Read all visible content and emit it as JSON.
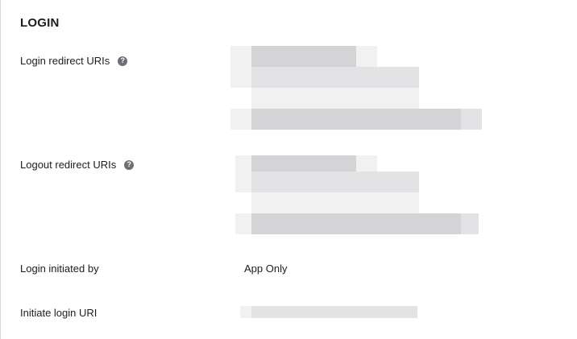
{
  "section": {
    "title": "LOGIN"
  },
  "fields": {
    "login_redirect": {
      "label": "Login redirect URIs",
      "help_icon": "question-circle-icon"
    },
    "logout_redirect": {
      "label": "Logout redirect URIs",
      "help_icon": "question-circle-icon"
    },
    "login_initiated_by": {
      "label": "Login initiated by",
      "value": "App Only"
    },
    "initiate_login_uri": {
      "label": "Initiate login URI"
    }
  },
  "colors": {
    "text": "#1d1d21",
    "help_icon_bg": "#6e6e78",
    "redaction_dark": "#d4d4d6",
    "redaction_mid": "#e3e3e5",
    "redaction_light": "#f1f1f2",
    "divider": "#d7d7dc"
  }
}
